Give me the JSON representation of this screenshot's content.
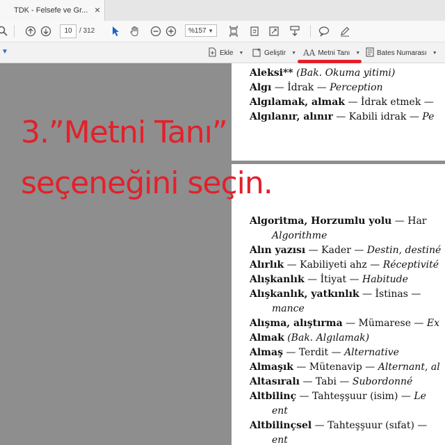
{
  "tab": {
    "title": "TDK - Felsefe ve Gr...",
    "close": "×"
  },
  "toolbar": {
    "search_icon": "search-icon",
    "page_current": "10",
    "page_total": "/ 312",
    "zoom": "%157",
    "icons": [
      "zoom-search-icon",
      "arrow-up-icon",
      "arrow-down-icon",
      "select-cursor-icon",
      "hand-icon",
      "zoom-out-icon",
      "zoom-in-icon",
      "fit-page-icon",
      "rotate-icon",
      "fullscreen-icon",
      "scroll-icon",
      "comment-icon",
      "pen-icon"
    ]
  },
  "tools": {
    "ekle": "Ekle",
    "gelistir": "Geliştir",
    "metni_tani": "Metni Tanı",
    "bates": "Bates Numarası"
  },
  "overlay": {
    "line1": "3.”Metni Tanı”",
    "line2": "seçeneğini seçin."
  },
  "page1_lines": [
    {
      "hw": "Aleksi**",
      "rest": " ",
      "it": "(Bak. Okuma yitimi)"
    },
    {
      "hw": "Algı",
      "rest": " — İdrak — ",
      "it": "Perception"
    },
    {
      "hw": "Algılamak, almak",
      "rest": " — İdrak etmek — ",
      "it": ""
    },
    {
      "hw": "Algılanır, alınır",
      "rest": " — Kabili idrak — ",
      "it": "Pe"
    }
  ],
  "page2_lines": [
    {
      "hw": "Algoritma, Horzumlu yolu",
      "rest": " — Har",
      "it": ""
    },
    {
      "hw": "",
      "rest": "",
      "it": "Algorithme",
      "indent": true
    },
    {
      "hw": "Alın yazısı",
      "rest": " — Kader — ",
      "it": "Destin, destiné"
    },
    {
      "hw": "Alırlık",
      "rest": " — Kabiliyeti ahz — ",
      "it": "Réceptivité"
    },
    {
      "hw": "Alışkanlık",
      "rest": " — İtiyat — ",
      "it": "Habitude"
    },
    {
      "hw": "Alışkanlık, yatkınlık",
      "rest": " — İstinas —",
      "it": ""
    },
    {
      "hw": "",
      "rest": "",
      "it": "mance",
      "indent": true
    },
    {
      "hw": "Alışma, alıştırma",
      "rest": " — Mümarese — ",
      "it": "Ex"
    },
    {
      "hw": "Almak",
      "rest": " ",
      "it": "(Bak. Algılamak)"
    },
    {
      "hw": "Almaş",
      "rest": " — Terdit — ",
      "it": "Alternative"
    },
    {
      "hw": "Almaşık",
      "rest": " — Mütenavip — ",
      "it": "Alternant, al"
    },
    {
      "hw": "Altasıralı",
      "rest": " — Tabi — ",
      "it": "Subordonné"
    },
    {
      "hw": "Altbilinç",
      "rest": " — Tahteşşuur (isim) — ",
      "it": "Le"
    },
    {
      "hw": "",
      "rest": "",
      "it": "ent",
      "indent": true
    },
    {
      "hw": "Altbilinçsel",
      "rest": " — Tahteşşuur (sıfat) —",
      "it": ""
    },
    {
      "hw": "",
      "rest": "",
      "it": "ent",
      "indent": true
    }
  ]
}
